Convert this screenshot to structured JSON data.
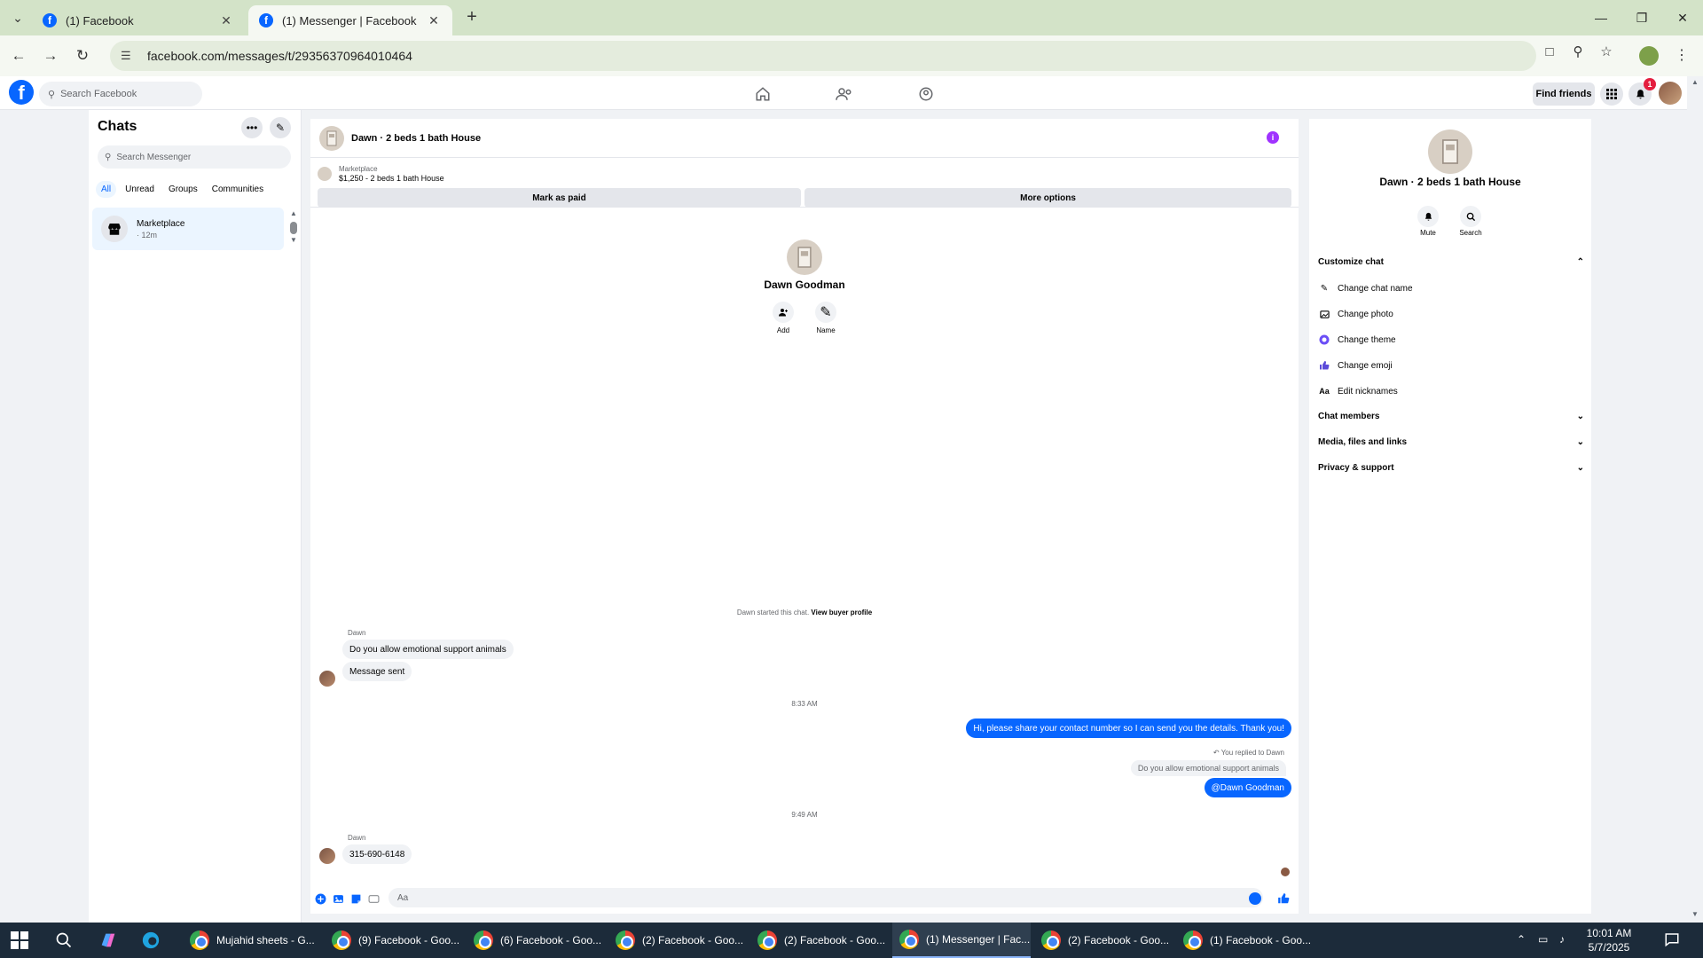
{
  "browser": {
    "tabs": [
      {
        "title": "(1) Facebook",
        "active": false
      },
      {
        "title": "(1) Messenger | Facebook",
        "active": true
      }
    ],
    "url": "facebook.com/messages/t/29356370964010464"
  },
  "fb": {
    "search_placeholder": "Search Facebook",
    "find_friends": "Find friends",
    "notification_count": "1"
  },
  "chats": {
    "title": "Chats",
    "search_placeholder": "Search Messenger",
    "filters": [
      "All",
      "Unread",
      "Groups",
      "Communities"
    ],
    "items": [
      {
        "name": "Marketplace",
        "time": "· 12m"
      }
    ]
  },
  "conversation": {
    "title": "Dawn · 2 beds 1 bath House",
    "marketplace_label": "Marketplace",
    "listing": "$1,250 - 2 beds 1 bath House",
    "mark_paid": "Mark as paid",
    "more_options": "More options",
    "profile_name": "Dawn Goodman",
    "add_label": "Add",
    "name_label": "Name",
    "system_text": "Dawn started this chat.",
    "view_buyer": "View buyer profile",
    "messages": [
      {
        "sender": "Dawn",
        "text": "Do you allow emotional support animals"
      },
      {
        "text": "Message sent"
      },
      {
        "time": "8:33 AM"
      },
      {
        "text": "Hi, please share your contact number so I can send you the details. Thank you!"
      },
      {
        "reply_note": "You replied to Dawn",
        "quote": "Do you allow emotional support animals",
        "text": "@Dawn Goodman"
      },
      {
        "time": "9:49 AM"
      },
      {
        "sender": "Dawn",
        "text": "315-690-6148"
      }
    ],
    "composer_placeholder": "Aa"
  },
  "info": {
    "name": "Dawn · 2 beds 1 bath House",
    "mute": "Mute",
    "search": "Search",
    "customize": "Customize chat",
    "rows": [
      "Change chat name",
      "Change photo",
      "Change theme",
      "Change emoji",
      "Edit nicknames"
    ],
    "sections": [
      "Chat members",
      "Media, files and links",
      "Privacy & support"
    ]
  },
  "taskbar": {
    "apps": [
      "Mujahid sheets - G...",
      "(9) Facebook - Goo...",
      "(6) Facebook - Goo...",
      "(2) Facebook - Goo...",
      "(2) Facebook - Goo...",
      "(1) Messenger | Fac...",
      "(2) Facebook - Goo...",
      "(1) Facebook - Goo..."
    ],
    "time": "10:01 AM",
    "date": "5/7/2025"
  },
  "colors": {
    "accent": "#0866ff",
    "tab_bar": "#d3e3c8",
    "taskbar": "#1c2b3a"
  }
}
